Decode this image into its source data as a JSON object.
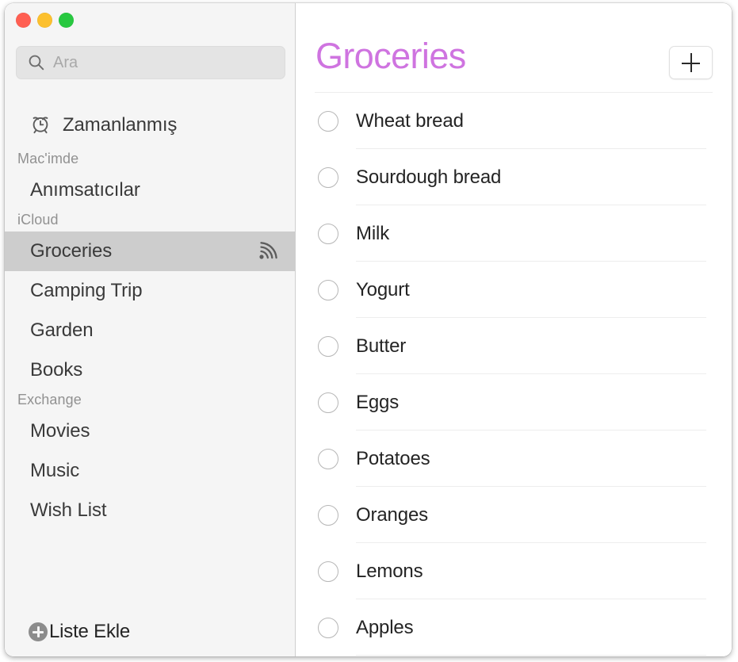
{
  "window": {
    "traffic_lights": [
      {
        "name": "close-button",
        "color": "#ff5f52"
      },
      {
        "name": "minimize-button",
        "color": "#fcc02e"
      },
      {
        "name": "maximize-button",
        "color": "#28c840"
      }
    ]
  },
  "sidebar": {
    "search": {
      "value": "",
      "placeholder": "Ara",
      "icon": "search-icon"
    },
    "smart_list": {
      "label": "Zamanlanmış",
      "icon": "alarm-clock-icon"
    },
    "groups": [
      {
        "header": "Mac'imde",
        "items": [
          {
            "label": "Anımsatıcılar",
            "selected": false,
            "shared": false
          }
        ]
      },
      {
        "header": "iCloud",
        "items": [
          {
            "label": "Groceries",
            "selected": true,
            "shared": true
          },
          {
            "label": "Camping Trip",
            "selected": false,
            "shared": false
          },
          {
            "label": "Garden",
            "selected": false,
            "shared": false
          },
          {
            "label": "Books",
            "selected": false,
            "shared": false
          }
        ]
      },
      {
        "header": "Exchange",
        "items": [
          {
            "label": "Movies",
            "selected": false,
            "shared": false
          },
          {
            "label": "Music",
            "selected": false,
            "shared": false
          },
          {
            "label": "Wish List",
            "selected": false,
            "shared": false
          }
        ]
      }
    ],
    "add_list": {
      "label": "Liste Ekle",
      "icon": "plus-circle-icon"
    }
  },
  "main": {
    "title": "Groceries",
    "title_color": "#cf74e0",
    "add_button": {
      "icon": "plus-icon",
      "label": ""
    },
    "items": [
      {
        "label": "Wheat bread",
        "completed": false
      },
      {
        "label": "Sourdough bread",
        "completed": false
      },
      {
        "label": "Milk",
        "completed": false
      },
      {
        "label": "Yogurt",
        "completed": false
      },
      {
        "label": "Butter",
        "completed": false
      },
      {
        "label": "Eggs",
        "completed": false
      },
      {
        "label": "Potatoes",
        "completed": false
      },
      {
        "label": "Oranges",
        "completed": false
      },
      {
        "label": "Lemons",
        "completed": false
      },
      {
        "label": "Apples",
        "completed": false
      }
    ]
  }
}
